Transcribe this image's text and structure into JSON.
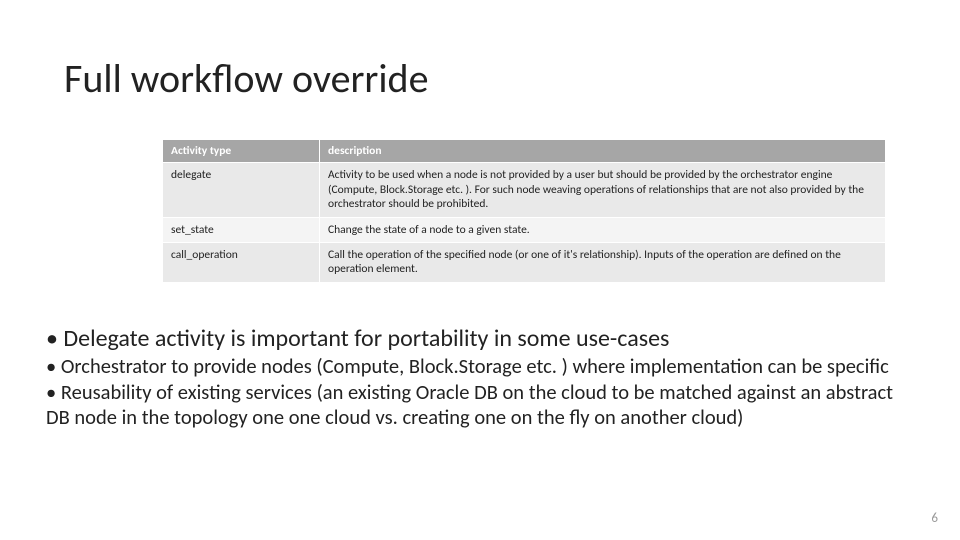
{
  "title": "Full workflow override",
  "table": {
    "headers": {
      "col1": "Activity type",
      "col2": "description"
    },
    "rows": [
      {
        "type": "delegate",
        "desc": "Activity to be used when a node is not provided by a user but should be provided by the orchestrator engine (Compute, Block.Storage etc. ). For such node weaving operations of relationships that are not also provided by the orchestrator should be prohibited."
      },
      {
        "type": "set_state",
        "desc": "Change the state of a node to a given state."
      },
      {
        "type": "call_operation",
        "desc": "Call the operation of the specified node (or one of it's relationship). Inputs of the operation are defined on the operation element."
      }
    ]
  },
  "bullets": {
    "main": "Delegate activity is important for portability in some use-cases",
    "subs": [
      "Orchestrator to provide nodes (Compute, Block.Storage etc. ) where implementation can be specific",
      "Reusability of existing services (an existing Oracle DB on the cloud to be matched against an abstract DB node in the topology one one cloud vs. creating one on the fly on another cloud)"
    ]
  },
  "page_number": "6"
}
